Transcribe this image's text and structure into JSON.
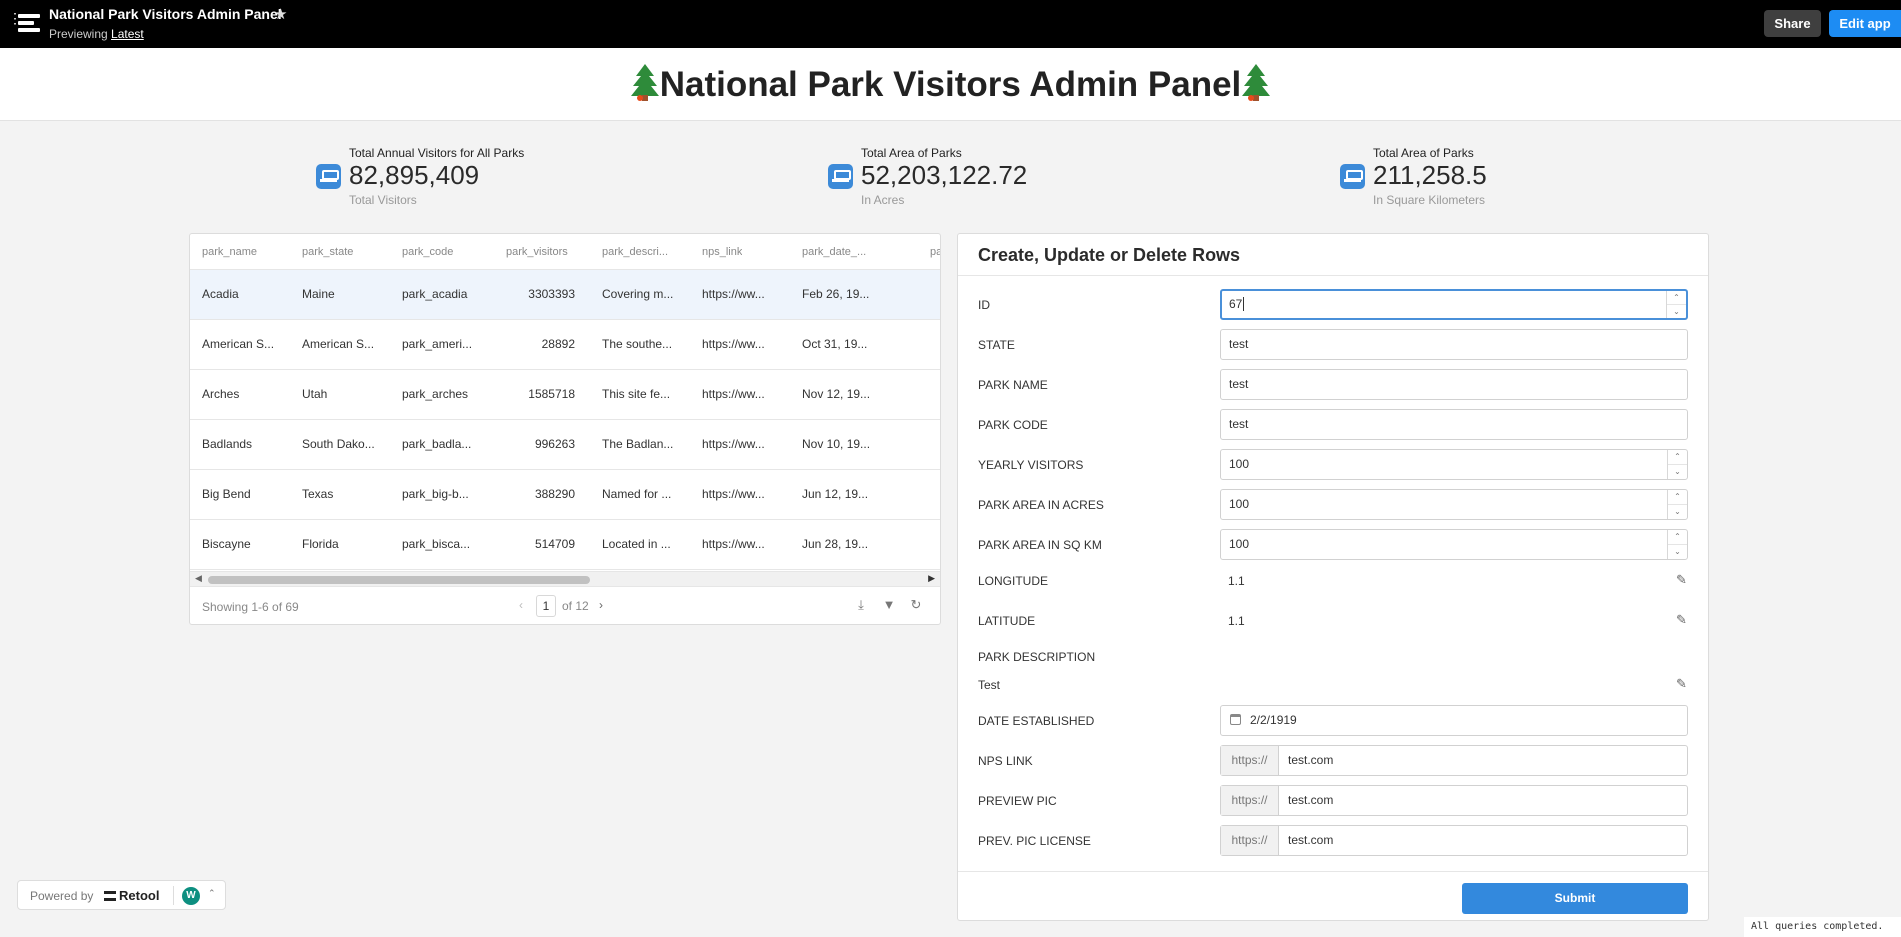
{
  "topbar": {
    "app_title": "National Park Visitors Admin Panel",
    "previewing_label": "Previewing",
    "version": "Latest",
    "share_label": "Share",
    "edit_label": "Edit app"
  },
  "header": {
    "title": "National Park Visitors Admin Panel"
  },
  "stats": [
    {
      "label": "Total Annual Visitors for All Parks",
      "value": "82,895,409",
      "sub": "Total Visitors"
    },
    {
      "label": "Total Area of Parks",
      "value": "52,203,122.72",
      "sub": "In Acres"
    },
    {
      "label": "Total Area of Parks",
      "value": "211,258.5",
      "sub": "In Square Kilometers"
    }
  ],
  "table": {
    "columns": [
      "park_name",
      "park_state",
      "park_code",
      "park_visitors",
      "park_descri...",
      "nps_link",
      "park_date_...",
      "pa"
    ],
    "rows": [
      [
        "Acadia",
        "Maine",
        "park_acadia",
        "3303393",
        "Covering m...",
        "https://ww...",
        "Feb 26, 19..."
      ],
      [
        "American S...",
        "American S...",
        "park_ameri...",
        "28892",
        "The southe...",
        "https://ww...",
        "Oct 31, 19..."
      ],
      [
        "Arches",
        "Utah",
        "park_arches",
        "1585718",
        "This site fe...",
        "https://ww...",
        "Nov 12, 19..."
      ],
      [
        "Badlands",
        "South Dako...",
        "park_badla...",
        "996263",
        "The Badlan...",
        "https://ww...",
        "Nov 10, 19..."
      ],
      [
        "Big Bend",
        "Texas",
        "park_big-b...",
        "388290",
        "Named for ...",
        "https://ww...",
        "Jun 12, 19..."
      ],
      [
        "Biscayne",
        "Florida",
        "park_bisca...",
        "514709",
        "Located in ...",
        "https://ww...",
        "Jun 28, 19..."
      ]
    ],
    "showing": "Showing 1-6 of 69",
    "page": "1",
    "page_of": "of 12"
  },
  "form": {
    "title": "Create, Update or Delete Rows",
    "labels": {
      "id": "ID",
      "state": "STATE",
      "park_name": "PARK NAME",
      "park_code": "PARK CODE",
      "yearly_visitors": "YEARLY VISITORS",
      "area_acres": "PARK AREA IN ACRES",
      "area_sqkm": "PARK AREA IN SQ KM",
      "longitude": "LONGITUDE",
      "latitude": "LATITUDE",
      "description": "PARK DESCRIPTION",
      "date_established": "DATE ESTABLISHED",
      "nps_link": "NPS LINK",
      "preview_pic": "PREVIEW PIC",
      "pic_license": "PREV. PIC LICENSE"
    },
    "values": {
      "id": "67",
      "state": "test",
      "park_name": "test",
      "park_code": "test",
      "yearly_visitors": "100",
      "area_acres": "100",
      "area_sqkm": "100",
      "longitude": "1.1",
      "latitude": "1.1",
      "description": "Test",
      "date_established": "2/2/1919",
      "nps_link": "test.com",
      "preview_pic": "test.com",
      "pic_license": "test.com"
    },
    "url_prefix": "https://",
    "submit_label": "Submit"
  },
  "footer": {
    "powered_by": "Powered by",
    "brand": "Retool",
    "avatar_initial": "W",
    "status": "All queries completed."
  },
  "colors": {
    "accent": "#1d8cf3",
    "topbar": "#000000",
    "submit": "#3389dd",
    "stat_icon": "#3c8ad8"
  },
  "icons": [
    "menu-icon",
    "retool-logo-icon",
    "star-icon",
    "tree-icon",
    "bench-icon",
    "download-icon",
    "filter-icon",
    "refresh-icon",
    "pencil-icon",
    "calendar-icon",
    "chevron-up-icon"
  ]
}
